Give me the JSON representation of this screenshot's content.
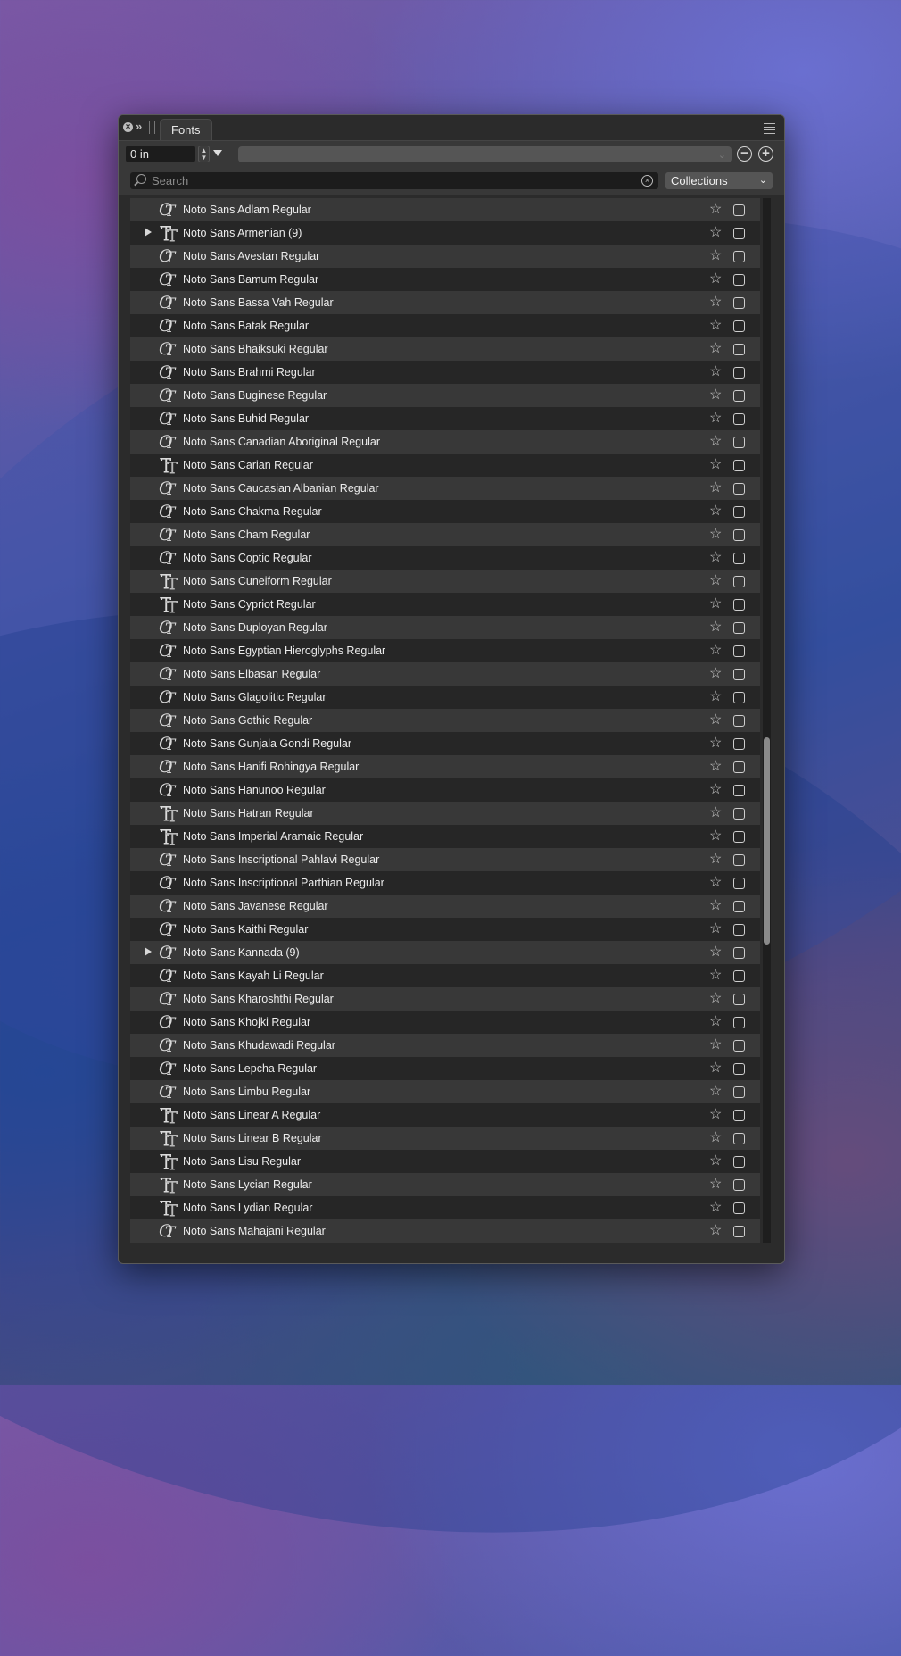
{
  "panel": {
    "tab_label": "Fonts"
  },
  "toolbar": {
    "size_value": "0 in",
    "search_placeholder": "Search",
    "collections_label": "Collections"
  },
  "fonts": [
    {
      "name": "Noto Sans Adlam Regular",
      "type": "opentype",
      "expandable": false
    },
    {
      "name": "Noto Sans Armenian (9)",
      "type": "truetype",
      "expandable": true
    },
    {
      "name": "Noto Sans Avestan Regular",
      "type": "opentype",
      "expandable": false
    },
    {
      "name": "Noto Sans Bamum Regular",
      "type": "opentype",
      "expandable": false
    },
    {
      "name": "Noto Sans Bassa Vah Regular",
      "type": "opentype",
      "expandable": false
    },
    {
      "name": "Noto Sans Batak Regular",
      "type": "opentype",
      "expandable": false
    },
    {
      "name": "Noto Sans Bhaiksuki Regular",
      "type": "opentype",
      "expandable": false
    },
    {
      "name": "Noto Sans Brahmi Regular",
      "type": "opentype",
      "expandable": false
    },
    {
      "name": "Noto Sans Buginese Regular",
      "type": "opentype",
      "expandable": false
    },
    {
      "name": "Noto Sans Buhid Regular",
      "type": "opentype",
      "expandable": false
    },
    {
      "name": "Noto Sans Canadian Aboriginal Regular",
      "type": "opentype",
      "expandable": false
    },
    {
      "name": "Noto Sans Carian Regular",
      "type": "truetype",
      "expandable": false
    },
    {
      "name": "Noto Sans Caucasian Albanian Regular",
      "type": "opentype",
      "expandable": false
    },
    {
      "name": "Noto Sans Chakma Regular",
      "type": "opentype",
      "expandable": false
    },
    {
      "name": "Noto Sans Cham Regular",
      "type": "opentype",
      "expandable": false
    },
    {
      "name": "Noto Sans Coptic Regular",
      "type": "opentype",
      "expandable": false
    },
    {
      "name": "Noto Sans Cuneiform Regular",
      "type": "truetype",
      "expandable": false
    },
    {
      "name": "Noto Sans Cypriot Regular",
      "type": "truetype",
      "expandable": false
    },
    {
      "name": "Noto Sans Duployan Regular",
      "type": "opentype",
      "expandable": false
    },
    {
      "name": "Noto Sans Egyptian Hieroglyphs Regular",
      "type": "opentype",
      "expandable": false
    },
    {
      "name": "Noto Sans Elbasan Regular",
      "type": "opentype",
      "expandable": false
    },
    {
      "name": "Noto Sans Glagolitic Regular",
      "type": "opentype",
      "expandable": false
    },
    {
      "name": "Noto Sans Gothic Regular",
      "type": "opentype",
      "expandable": false
    },
    {
      "name": "Noto Sans Gunjala Gondi Regular",
      "type": "opentype",
      "expandable": false
    },
    {
      "name": "Noto Sans Hanifi Rohingya Regular",
      "type": "opentype",
      "expandable": false
    },
    {
      "name": "Noto Sans Hanunoo Regular",
      "type": "opentype",
      "expandable": false
    },
    {
      "name": "Noto Sans Hatran Regular",
      "type": "truetype",
      "expandable": false
    },
    {
      "name": "Noto Sans Imperial Aramaic Regular",
      "type": "truetype",
      "expandable": false
    },
    {
      "name": "Noto Sans Inscriptional Pahlavi Regular",
      "type": "opentype",
      "expandable": false
    },
    {
      "name": "Noto Sans Inscriptional Parthian Regular",
      "type": "opentype",
      "expandable": false
    },
    {
      "name": "Noto Sans Javanese Regular",
      "type": "opentype",
      "expandable": false
    },
    {
      "name": "Noto Sans Kaithi Regular",
      "type": "opentype",
      "expandable": false
    },
    {
      "name": "Noto Sans Kannada (9)",
      "type": "opentype",
      "expandable": true
    },
    {
      "name": "Noto Sans Kayah Li Regular",
      "type": "opentype",
      "expandable": false
    },
    {
      "name": "Noto Sans Kharoshthi Regular",
      "type": "opentype",
      "expandable": false
    },
    {
      "name": "Noto Sans Khojki Regular",
      "type": "opentype",
      "expandable": false
    },
    {
      "name": "Noto Sans Khudawadi Regular",
      "type": "opentype",
      "expandable": false
    },
    {
      "name": "Noto Sans Lepcha Regular",
      "type": "opentype",
      "expandable": false
    },
    {
      "name": "Noto Sans Limbu Regular",
      "type": "opentype",
      "expandable": false
    },
    {
      "name": "Noto Sans Linear A Regular",
      "type": "truetype",
      "expandable": false
    },
    {
      "name": "Noto Sans Linear B Regular",
      "type": "truetype",
      "expandable": false
    },
    {
      "name": "Noto Sans Lisu Regular",
      "type": "truetype",
      "expandable": false
    },
    {
      "name": "Noto Sans Lycian Regular",
      "type": "truetype",
      "expandable": false
    },
    {
      "name": "Noto Sans Lydian Regular",
      "type": "truetype",
      "expandable": false
    },
    {
      "name": "Noto Sans Mahajani Regular",
      "type": "opentype",
      "expandable": false
    }
  ]
}
